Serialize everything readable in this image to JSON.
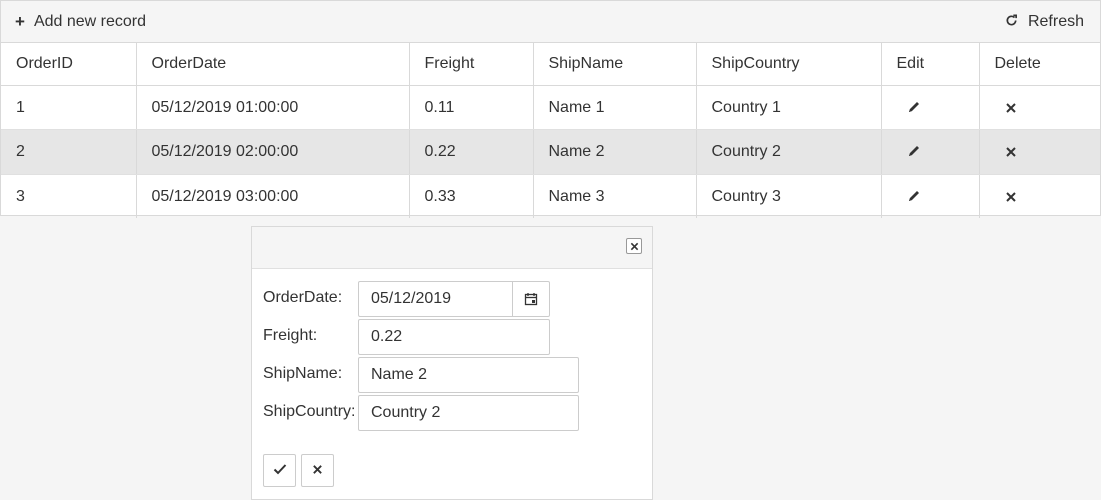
{
  "toolbar": {
    "add_label": "Add new record",
    "add_icon": "plus-icon",
    "refresh_label": "Refresh",
    "refresh_icon": "refresh-icon"
  },
  "table": {
    "columns": [
      "OrderID",
      "OrderDate",
      "Freight",
      "ShipName",
      "ShipCountry",
      "Edit",
      "Delete"
    ],
    "rows": [
      {
        "OrderID": "1",
        "OrderDate": "05/12/2019 01:00:00",
        "Freight": "0.11",
        "ShipName": "Name 1",
        "ShipCountry": "Country 1"
      },
      {
        "OrderID": "2",
        "OrderDate": "05/12/2019 02:00:00",
        "Freight": "0.22",
        "ShipName": "Name 2",
        "ShipCountry": "Country 2"
      },
      {
        "OrderID": "3",
        "OrderDate": "05/12/2019 03:00:00",
        "Freight": "0.33",
        "ShipName": "Name 3",
        "ShipCountry": "Country 3"
      }
    ],
    "selected_row": 1
  },
  "popup": {
    "fields": {
      "orderdate_label": "OrderDate:",
      "orderdate_value": "05/12/2019",
      "freight_label": "Freight:",
      "freight_value": "0.22",
      "shipname_label": "ShipName:",
      "shipname_value": "Name 2",
      "shipcountry_label": "ShipCountry:",
      "shipcountry_value": "Country 2"
    }
  },
  "colors": {
    "selected_row_bg": "#e6e6e6",
    "border": "#d9d9d9",
    "toolbar_bg": "#f5f5f5"
  }
}
